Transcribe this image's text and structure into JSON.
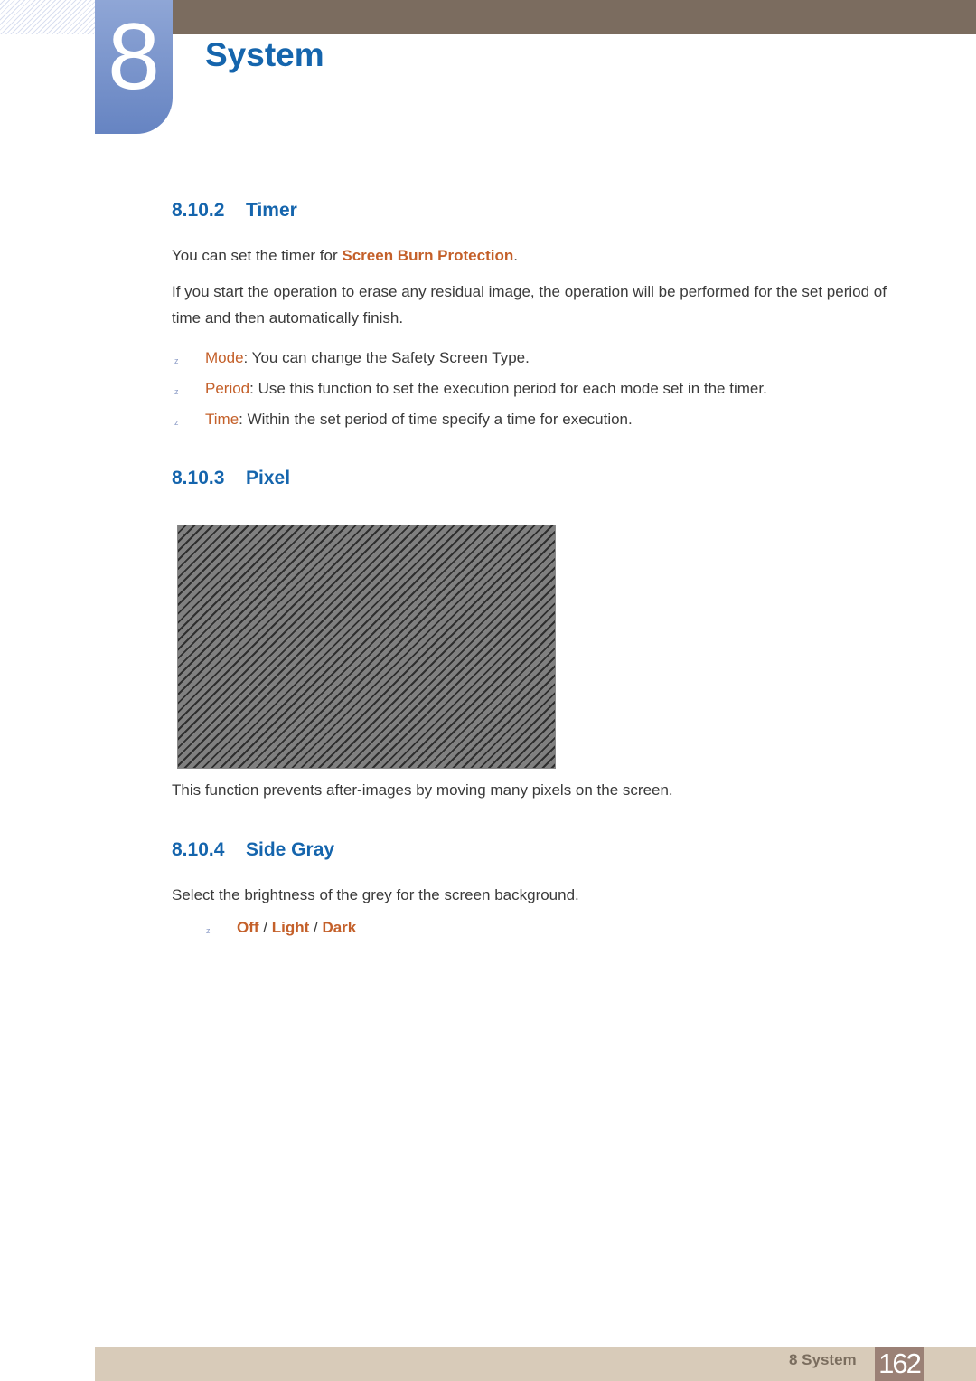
{
  "header": {
    "chapter_number": "8",
    "chapter_title": "System"
  },
  "sections": {
    "timer": {
      "number": "8.10.2",
      "title": "Timer",
      "intro_prefix": "You can set the timer for ",
      "intro_link": "Screen Burn Protection",
      "intro_suffix": ".",
      "paragraph": "If you start the operation to erase any residual image, the operation will be performed for the set period of time and then automatically finish.",
      "bullets": [
        {
          "term": "Mode",
          "text": ": You can change the Safety Screen Type."
        },
        {
          "term": "Period",
          "text": ": Use this function to set the execution period for each mode set in the timer."
        },
        {
          "term": "Time",
          "text": ": Within the set period of time specify a time for execution."
        }
      ]
    },
    "pixel": {
      "number": "8.10.3",
      "title": "Pixel",
      "image_alt": "diagonal pixel pattern",
      "description": "This function prevents after-images by moving many pixels on the screen."
    },
    "side_gray": {
      "number": "8.10.4",
      "title": "Side Gray",
      "description": "Select the brightness of the grey for the screen background.",
      "options": [
        "Off",
        "Light",
        "Dark"
      ],
      "separator": " / "
    }
  },
  "bullet_marker": "z",
  "footer": {
    "section_label": "8 System",
    "page_number": "162"
  },
  "colors": {
    "heading_blue": "#1565ad",
    "highlight_orange": "#c4602a",
    "top_bar": "#7b6c5f",
    "footer_bar": "#d8cbb9",
    "page_box": "#9b8176"
  }
}
